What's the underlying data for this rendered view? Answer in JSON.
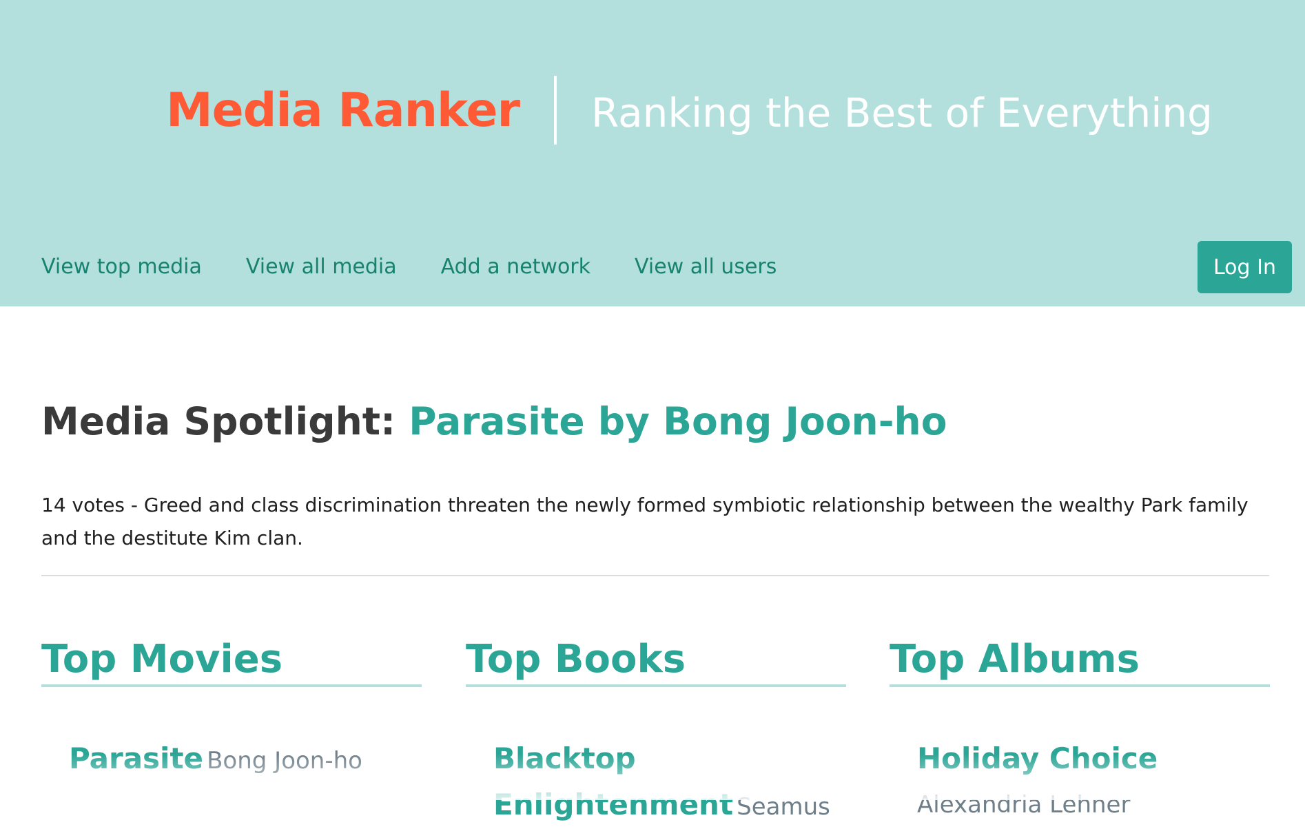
{
  "header": {
    "site_title": "Media Ranker",
    "tagline": "Ranking the Best of Everything",
    "nav": [
      {
        "label": "View top media"
      },
      {
        "label": "View all media"
      },
      {
        "label": "Add a network"
      },
      {
        "label": "View all users"
      }
    ],
    "login_label": "Log In"
  },
  "spotlight": {
    "label": "Media Spotlight: ",
    "link_text": "Parasite by Bong Joon-ho",
    "description": "14 votes - Greed and class discrimination threaten the newly formed symbiotic relationship between the wealthy Park family and the destitute Kim clan."
  },
  "columns": [
    {
      "heading": "Top Movies",
      "items": [
        {
          "title": "Parasite",
          "creator": "Bong Joon-ho"
        }
      ]
    },
    {
      "heading": "Top Books",
      "items": [
        {
          "title": "Blacktop Enlightenment",
          "creator": "Seamus"
        }
      ]
    },
    {
      "heading": "Top Albums",
      "items": [
        {
          "title": "Holiday Choice",
          "creator": "Alexandria Lehner"
        }
      ]
    }
  ],
  "colors": {
    "header_bg": "#b3e0dc",
    "brand": "#ff5a36",
    "accent": "#2aa596",
    "nav_link": "#17826f"
  }
}
